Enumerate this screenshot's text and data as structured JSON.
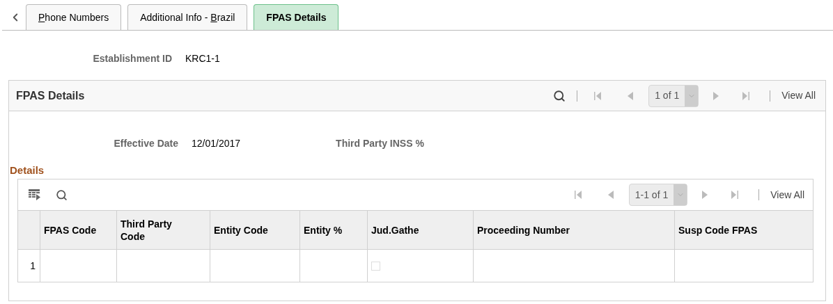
{
  "tabs": [
    {
      "access_key": "P",
      "after": "hone Numbers",
      "selected": false
    },
    {
      "before": "Additional Info - ",
      "access_key": "B",
      "after": "razil",
      "selected": false
    },
    {
      "before": "FPAS Details",
      "selected": true
    }
  ],
  "establishment": {
    "label": "Establishment ID",
    "value": "KRC1-1"
  },
  "panel": {
    "title": "FPAS Details",
    "pager": {
      "count": "1 of 1",
      "view_all": "View All"
    },
    "fields": [
      {
        "label": "Effective Date",
        "value": "12/01/2017"
      },
      {
        "label": "Third Party INSS %"
      }
    ],
    "details": {
      "title": "Details",
      "pager": {
        "count": "1-1 of 1",
        "view_all": "View All"
      },
      "columns": [
        "FPAS Code",
        "Third Party Code",
        "Entity Code",
        "Entity %",
        "Jud.Gathe",
        "Proceeding Number",
        "Susp Code FPAS"
      ],
      "rows": [
        {
          "number": "1",
          "jud_gathe_checked": false
        }
      ]
    }
  }
}
